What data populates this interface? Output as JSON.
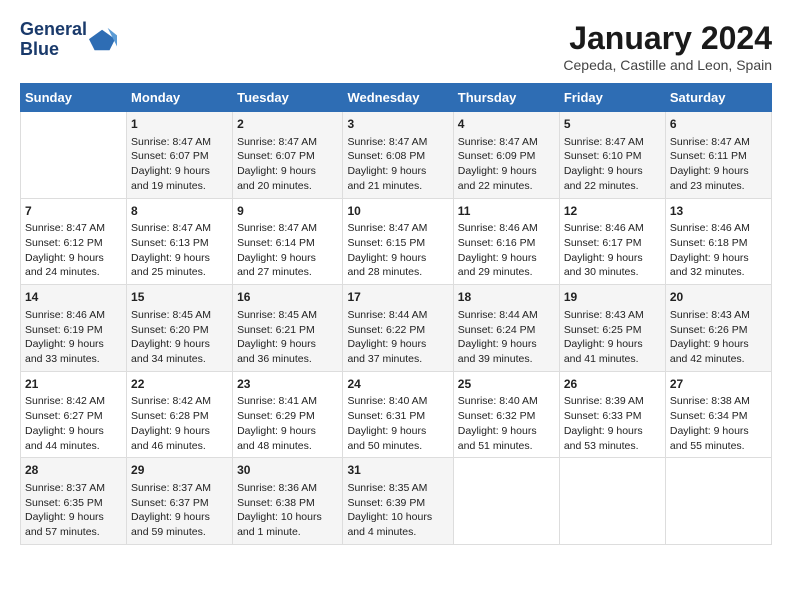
{
  "logo": {
    "line1": "General",
    "line2": "Blue"
  },
  "title": "January 2024",
  "subtitle": "Cepeda, Castille and Leon, Spain",
  "days_header": [
    "Sunday",
    "Monday",
    "Tuesday",
    "Wednesday",
    "Thursday",
    "Friday",
    "Saturday"
  ],
  "weeks": [
    [
      {
        "day": "",
        "content": ""
      },
      {
        "day": "1",
        "content": "Sunrise: 8:47 AM\nSunset: 6:07 PM\nDaylight: 9 hours\nand 19 minutes."
      },
      {
        "day": "2",
        "content": "Sunrise: 8:47 AM\nSunset: 6:07 PM\nDaylight: 9 hours\nand 20 minutes."
      },
      {
        "day": "3",
        "content": "Sunrise: 8:47 AM\nSunset: 6:08 PM\nDaylight: 9 hours\nand 21 minutes."
      },
      {
        "day": "4",
        "content": "Sunrise: 8:47 AM\nSunset: 6:09 PM\nDaylight: 9 hours\nand 22 minutes."
      },
      {
        "day": "5",
        "content": "Sunrise: 8:47 AM\nSunset: 6:10 PM\nDaylight: 9 hours\nand 22 minutes."
      },
      {
        "day": "6",
        "content": "Sunrise: 8:47 AM\nSunset: 6:11 PM\nDaylight: 9 hours\nand 23 minutes."
      }
    ],
    [
      {
        "day": "7",
        "content": "Sunrise: 8:47 AM\nSunset: 6:12 PM\nDaylight: 9 hours\nand 24 minutes."
      },
      {
        "day": "8",
        "content": "Sunrise: 8:47 AM\nSunset: 6:13 PM\nDaylight: 9 hours\nand 25 minutes."
      },
      {
        "day": "9",
        "content": "Sunrise: 8:47 AM\nSunset: 6:14 PM\nDaylight: 9 hours\nand 27 minutes."
      },
      {
        "day": "10",
        "content": "Sunrise: 8:47 AM\nSunset: 6:15 PM\nDaylight: 9 hours\nand 28 minutes."
      },
      {
        "day": "11",
        "content": "Sunrise: 8:46 AM\nSunset: 6:16 PM\nDaylight: 9 hours\nand 29 minutes."
      },
      {
        "day": "12",
        "content": "Sunrise: 8:46 AM\nSunset: 6:17 PM\nDaylight: 9 hours\nand 30 minutes."
      },
      {
        "day": "13",
        "content": "Sunrise: 8:46 AM\nSunset: 6:18 PM\nDaylight: 9 hours\nand 32 minutes."
      }
    ],
    [
      {
        "day": "14",
        "content": "Sunrise: 8:46 AM\nSunset: 6:19 PM\nDaylight: 9 hours\nand 33 minutes."
      },
      {
        "day": "15",
        "content": "Sunrise: 8:45 AM\nSunset: 6:20 PM\nDaylight: 9 hours\nand 34 minutes."
      },
      {
        "day": "16",
        "content": "Sunrise: 8:45 AM\nSunset: 6:21 PM\nDaylight: 9 hours\nand 36 minutes."
      },
      {
        "day": "17",
        "content": "Sunrise: 8:44 AM\nSunset: 6:22 PM\nDaylight: 9 hours\nand 37 minutes."
      },
      {
        "day": "18",
        "content": "Sunrise: 8:44 AM\nSunset: 6:24 PM\nDaylight: 9 hours\nand 39 minutes."
      },
      {
        "day": "19",
        "content": "Sunrise: 8:43 AM\nSunset: 6:25 PM\nDaylight: 9 hours\nand 41 minutes."
      },
      {
        "day": "20",
        "content": "Sunrise: 8:43 AM\nSunset: 6:26 PM\nDaylight: 9 hours\nand 42 minutes."
      }
    ],
    [
      {
        "day": "21",
        "content": "Sunrise: 8:42 AM\nSunset: 6:27 PM\nDaylight: 9 hours\nand 44 minutes."
      },
      {
        "day": "22",
        "content": "Sunrise: 8:42 AM\nSunset: 6:28 PM\nDaylight: 9 hours\nand 46 minutes."
      },
      {
        "day": "23",
        "content": "Sunrise: 8:41 AM\nSunset: 6:29 PM\nDaylight: 9 hours\nand 48 minutes."
      },
      {
        "day": "24",
        "content": "Sunrise: 8:40 AM\nSunset: 6:31 PM\nDaylight: 9 hours\nand 50 minutes."
      },
      {
        "day": "25",
        "content": "Sunrise: 8:40 AM\nSunset: 6:32 PM\nDaylight: 9 hours\nand 51 minutes."
      },
      {
        "day": "26",
        "content": "Sunrise: 8:39 AM\nSunset: 6:33 PM\nDaylight: 9 hours\nand 53 minutes."
      },
      {
        "day": "27",
        "content": "Sunrise: 8:38 AM\nSunset: 6:34 PM\nDaylight: 9 hours\nand 55 minutes."
      }
    ],
    [
      {
        "day": "28",
        "content": "Sunrise: 8:37 AM\nSunset: 6:35 PM\nDaylight: 9 hours\nand 57 minutes."
      },
      {
        "day": "29",
        "content": "Sunrise: 8:37 AM\nSunset: 6:37 PM\nDaylight: 9 hours\nand 59 minutes."
      },
      {
        "day": "30",
        "content": "Sunrise: 8:36 AM\nSunset: 6:38 PM\nDaylight: 10 hours\nand 1 minute."
      },
      {
        "day": "31",
        "content": "Sunrise: 8:35 AM\nSunset: 6:39 PM\nDaylight: 10 hours\nand 4 minutes."
      },
      {
        "day": "",
        "content": ""
      },
      {
        "day": "",
        "content": ""
      },
      {
        "day": "",
        "content": ""
      }
    ]
  ]
}
